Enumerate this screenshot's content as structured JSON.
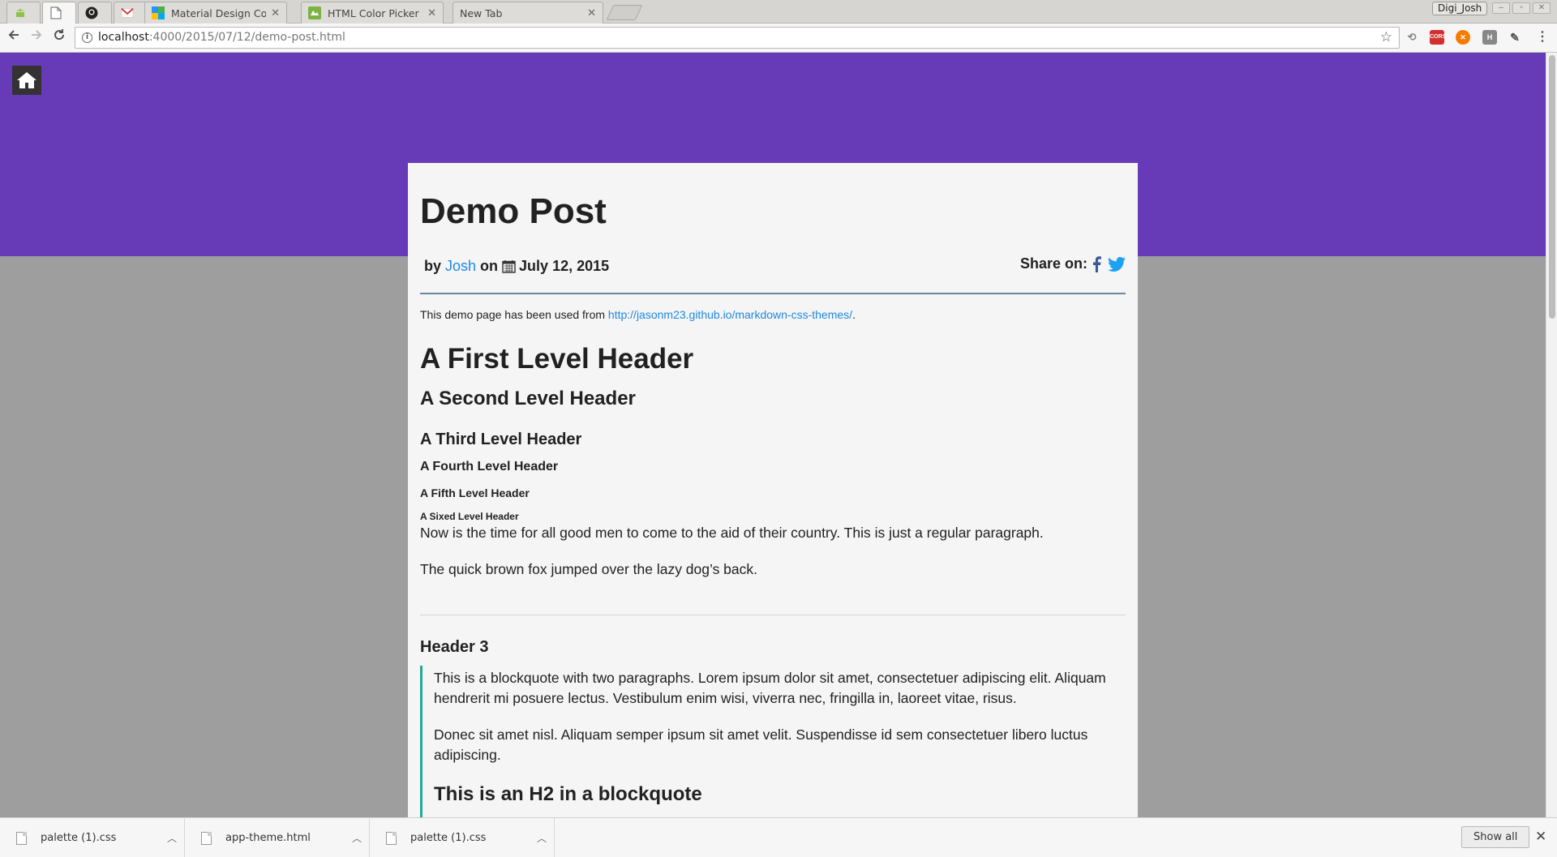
{
  "browser": {
    "tabs": [
      {
        "title": ""
      },
      {
        "title": ""
      },
      {
        "title": ""
      },
      {
        "title": ""
      },
      {
        "title": "Material Design Color"
      },
      {
        "title": "HTML Color Picker"
      },
      {
        "title": "New Tab"
      }
    ],
    "profile_name": "Digi_Josh",
    "url_host": "localhost",
    "url_path": ":4000/2015/07/12/demo-post.html"
  },
  "page": {
    "title": "Demo Post",
    "meta": {
      "by_label": "by",
      "author": "Josh",
      "on_label": "on",
      "date": "July 12, 2015"
    },
    "share_label": "Share on:",
    "intro_text": "This demo page has been used from ",
    "intro_link": "http://jasonm23.github.io/markdown-css-themes/",
    "intro_end": ".",
    "h1": "A First Level Header",
    "h2": "A Second Level Header",
    "h3": "A Third Level Header",
    "h4": "A Fourth Level Header",
    "h5": "A Fifth Level Header",
    "h6": "A Sixed Level Header",
    "para1": "Now is the time for all good men to come to the aid of their country. This is just a regular paragraph.",
    "para2": "The quick brown fox jumped over the lazy dog’s back.",
    "header3": "Header 3",
    "blockquote": {
      "p1": "This is a blockquote with two paragraphs. Lorem ipsum dolor sit amet, consectetuer adipiscing elit. Aliquam hendrerit mi posuere lectus. Vestibulum enim wisi, viverra nec, fringilla in, laoreet vitae, risus.",
      "p2": "Donec sit amet nisl. Aliquam semper ipsum sit amet velit. Suspendisse id sem consectetuer libero luctus adipiscing.",
      "h2": "This is an H2 in a blockquote"
    }
  },
  "downloads": {
    "items": [
      {
        "name": "palette (1).css"
      },
      {
        "name": "app-theme.html"
      },
      {
        "name": "palette (1).css"
      }
    ],
    "show_all_label": "Show all"
  },
  "colors": {
    "hero": "#673ab7",
    "link": "#1e88e5",
    "blockquote_border": "#26a69a",
    "background": "#9e9e9e"
  }
}
